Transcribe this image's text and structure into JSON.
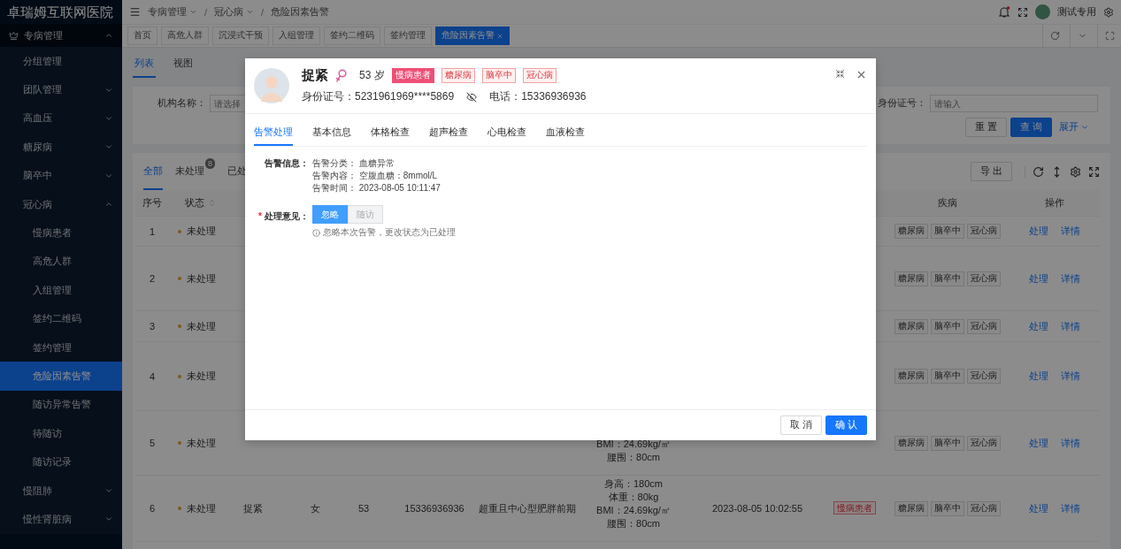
{
  "sidebar": {
    "title": "卓瑞姆互联网医院",
    "items": [
      {
        "label": "专病管理",
        "kind": "group",
        "expanded": true,
        "children": [
          {
            "label": "分组管理",
            "kind": "link",
            "selected": false
          },
          {
            "label": "团队管理",
            "kind": "group",
            "expanded": false
          },
          {
            "label": "高血压",
            "kind": "group",
            "expanded": false
          },
          {
            "label": "糖尿病",
            "kind": "group",
            "expanded": false
          },
          {
            "label": "脑卒中",
            "kind": "group",
            "expanded": false
          },
          {
            "label": "冠心病",
            "kind": "group",
            "expanded": true,
            "children": [
              {
                "label": "慢病患者",
                "kind": "link",
                "selected": false
              },
              {
                "label": "高危人群",
                "kind": "link",
                "selected": false
              },
              {
                "label": "入组管理",
                "kind": "link",
                "selected": false
              },
              {
                "label": "签约二维码",
                "kind": "link",
                "selected": false
              },
              {
                "label": "签约管理",
                "kind": "link",
                "selected": false
              },
              {
                "label": "危险因素告警",
                "kind": "link",
                "selected": true
              },
              {
                "label": "随访异常告警",
                "kind": "link",
                "selected": false
              },
              {
                "label": "待随访",
                "kind": "link",
                "selected": false
              },
              {
                "label": "随访记录",
                "kind": "link",
                "selected": false
              }
            ]
          },
          {
            "label": "慢阻肺",
            "kind": "group",
            "expanded": false
          },
          {
            "label": "慢性肾脏病",
            "kind": "group",
            "expanded": false
          }
        ]
      }
    ]
  },
  "header": {
    "separator": "/",
    "breadcrumb": [
      {
        "label": "专病管理",
        "dropdown": true
      },
      {
        "label": "冠心病",
        "dropdown": true
      },
      {
        "label": "危险因素告警",
        "dropdown": false
      }
    ],
    "notification": true,
    "user": "测试专用"
  },
  "open_tabs": [
    {
      "label": "首页",
      "selected": false,
      "closable": false
    },
    {
      "label": "高危人群",
      "selected": false,
      "closable": false
    },
    {
      "label": "沉浸式干预",
      "selected": false,
      "closable": false
    },
    {
      "label": "入组管理",
      "selected": false,
      "closable": false
    },
    {
      "label": "签约二维码",
      "selected": false,
      "closable": false
    },
    {
      "label": "签约管理",
      "selected": false,
      "closable": false
    },
    {
      "label": "危险因素告警",
      "selected": true,
      "closable": true
    }
  ],
  "view_tabs": [
    {
      "label": "列表",
      "selected": true
    },
    {
      "label": "视图",
      "selected": false
    }
  ],
  "search": {
    "fields": [
      {
        "label": "机构名称：",
        "placeholder": "请选择"
      },
      {
        "label": "身份证号：",
        "placeholder": "请输入"
      }
    ],
    "buttons": [
      {
        "label": "重 置",
        "kind": "default"
      },
      {
        "label": "查 询",
        "kind": "primary"
      }
    ],
    "expand": "展开"
  },
  "table": {
    "filter_tabs": [
      {
        "label": "全部",
        "selected": true
      },
      {
        "label": "未处理",
        "selected": false,
        "badge": "8"
      },
      {
        "label": "已处",
        "selected": false
      }
    ],
    "export": "导 出",
    "columns": {
      "seq": "序号",
      "status": "状态",
      "diseases": "疾病",
      "actions": "操作"
    },
    "rows": [
      {
        "seq": "1",
        "status": "未处理",
        "diseases": [
          "糖尿病",
          "脑卒中",
          "冠心病"
        ],
        "actions": [
          "处理",
          "详情"
        ]
      },
      {
        "seq": "2",
        "status": "未处理",
        "diseases": [
          "糖尿病",
          "脑卒中",
          "冠心病"
        ],
        "actions": [
          "处理",
          "详情"
        ]
      },
      {
        "seq": "3",
        "status": "未处理",
        "diseases": [
          "糖尿病",
          "脑卒中",
          "冠心病"
        ],
        "actions": [
          "处理",
          "详情"
        ]
      },
      {
        "seq": "4",
        "status": "未处理",
        "diseases": [
          "糖尿病",
          "脑卒中",
          "冠心病"
        ],
        "actions": [
          "处理",
          "详情"
        ]
      },
      {
        "seq": "5",
        "status": "未处理",
        "measures": [
          "BMI：24.69kg/㎡",
          "腰围：80cm"
        ],
        "diseases": [
          "糖尿病",
          "脑卒中",
          "冠心病"
        ],
        "actions": [
          "处理",
          "详情"
        ]
      },
      {
        "seq": "6",
        "status": "未处理",
        "name": "捉紧",
        "gender": "女",
        "age": "53",
        "phone": "15336936936",
        "diagnosis": "超重且中心型肥胖前期",
        "measures": [
          "身高：180cm",
          "体重：80kg",
          "BMI：24.69kg/㎡",
          "腰围：80cm"
        ],
        "time": "2023-08-05 10:02:55",
        "tag": "慢病患者",
        "diseases": [
          "糖尿病",
          "脑卒中",
          "冠心病"
        ],
        "actions": [
          "处理",
          "详情"
        ]
      }
    ]
  },
  "dialog": {
    "patient": {
      "name": "捉紧",
      "age": "53 岁",
      "tags": [
        {
          "label": "慢病患者",
          "kind": "filled"
        },
        {
          "label": "糖尿病",
          "kind": "outline"
        },
        {
          "label": "脑卒中",
          "kind": "outline"
        },
        {
          "label": "冠心病",
          "kind": "outline"
        }
      ],
      "id": "身份证号：5231961969****5869",
      "phone": "电话：15336936936"
    },
    "tabs": [
      {
        "label": "告警处理",
        "selected": true
      },
      {
        "label": "基本信息",
        "selected": false
      },
      {
        "label": "体格检查",
        "selected": false
      },
      {
        "label": "超声检查",
        "selected": false
      },
      {
        "label": "心电检查",
        "selected": false
      },
      {
        "label": "血液检查",
        "selected": false
      }
    ],
    "alert": {
      "label": "告警信息：",
      "items": [
        {
          "label": "告警分类：",
          "value": "血糖异常"
        },
        {
          "label": "告警内容：",
          "value": "空腹血糖：8mmol/L"
        },
        {
          "label": "告警时间：",
          "value": "2023-08-05 10:11:47"
        }
      ]
    },
    "opinion": {
      "label": "处理意见：",
      "required_mark": "*",
      "options": [
        {
          "label": "忽略",
          "selected": true
        },
        {
          "label": "随访",
          "selected": false
        }
      ],
      "hint": "忽略本次告警，更改状态为已处理"
    },
    "buttons": [
      {
        "label": "取 消",
        "kind": "default"
      },
      {
        "label": "确 认",
        "kind": "primary"
      }
    ]
  }
}
